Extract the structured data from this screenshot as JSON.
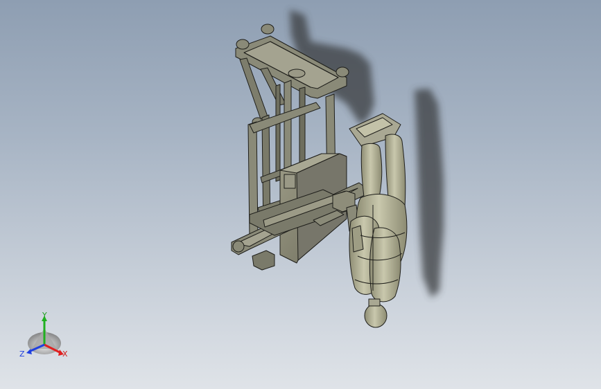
{
  "viewport": {
    "background_top": "#8e9eb2",
    "background_bottom": "#dfe3e8"
  },
  "model": {
    "frame_color": "#8a8a78",
    "edge_color": "#1e1e1a",
    "figure_color": "#b6b59a",
    "shadow_color": "#3a3c40"
  },
  "triad": {
    "x_label": "X",
    "y_label": "Y",
    "z_label": "Z",
    "x_color": "#e02020",
    "y_color": "#20b020",
    "z_color": "#2040e0"
  }
}
